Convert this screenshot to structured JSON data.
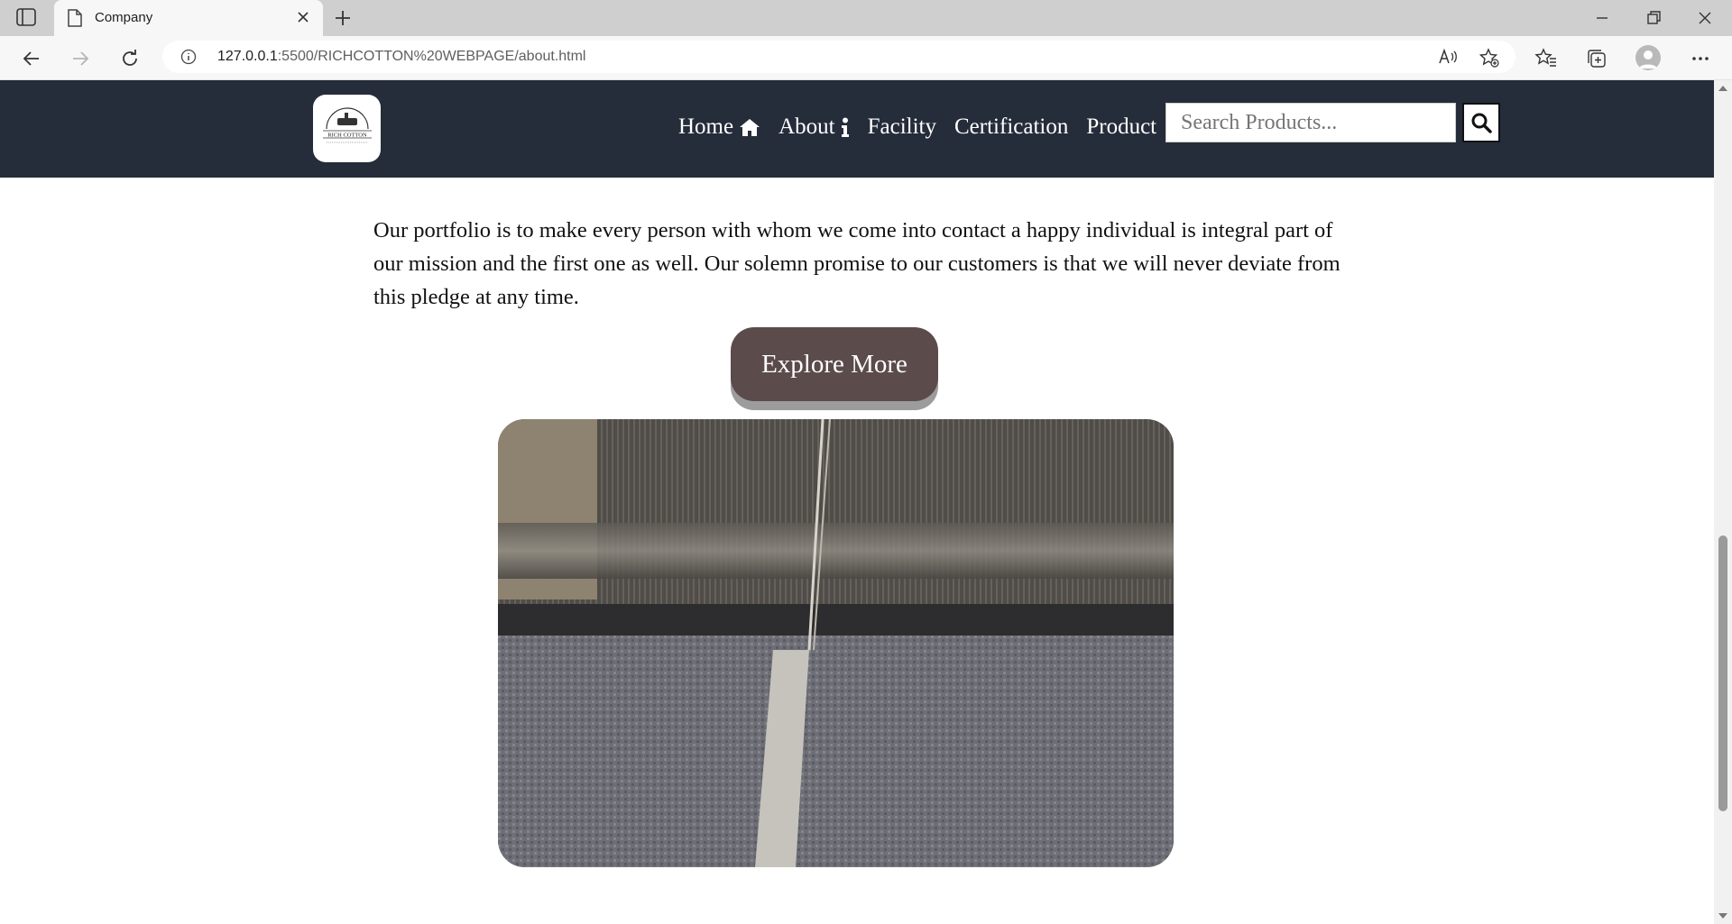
{
  "browser": {
    "tab_title": "Company",
    "url_host": "127.0.0.1",
    "url_rest": ":5500/RICHCOTTON%20WEBPAGE/about.html"
  },
  "site": {
    "logo_text": "RICH COTTON",
    "nav": [
      {
        "label": "Home",
        "icon": "home-icon"
      },
      {
        "label": "About",
        "icon": "info-icon"
      },
      {
        "label": "Facility"
      },
      {
        "label": "Certification"
      },
      {
        "label": "Product"
      }
    ],
    "search_placeholder": "Search Products..."
  },
  "content": {
    "paragraph": "Our portfolio is to make every person with whom we come into contact a happy individual is integral part of our mission and the first one as well. Our solemn promise to our customers is that we will never deviate from this pledge at any time.",
    "cta_label": "Explore More",
    "image": "weaving-loom-photo"
  },
  "colors": {
    "header_bg": "#252c3a",
    "cta_bg": "#5b4b4b"
  }
}
